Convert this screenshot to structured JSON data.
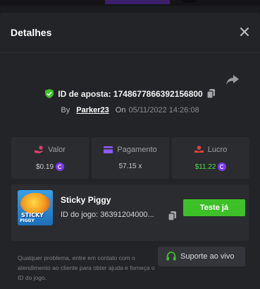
{
  "modal": {
    "title": "Detalhes"
  },
  "bet": {
    "id_label": "ID de aposta: 1748677866392156800",
    "by_label": "By",
    "username": "Parker23",
    "on_label": "On",
    "date": "05/11/2022 14:26:08"
  },
  "stats": {
    "valor": {
      "label": "Valor",
      "value": "$0.19"
    },
    "pagamento": {
      "label": "Pagamento",
      "value": "57.15 x"
    },
    "lucro": {
      "label": "Lucro",
      "value": "$11.22"
    }
  },
  "game": {
    "name": "Sticky Piggy",
    "id_text": "ID do jogo: 36391204000...",
    "thumb_line1": "STICKY",
    "thumb_line2": "PIGGY",
    "play_label": "Teste já"
  },
  "help": {
    "text": "Qualquer problema, entre em contato com o atendimento ao cliente para obter ajuda e forneça o ID do jogo.",
    "support_label": "Suporte ao vivo"
  },
  "icons": {
    "close": "close-icon",
    "share": "share-icon",
    "shield": "shield-check-icon",
    "copy": "copy-icon",
    "valor": "bet-hand-icon",
    "pagamento": "card-icon",
    "lucro": "profit-hand-icon",
    "coin": "coin-icon",
    "headset": "headset-icon"
  },
  "colors": {
    "accent_green": "#3ec028",
    "profit_green": "#4ade4a",
    "coin_purple": "#7c3aed",
    "valor_pink": "#e0406a",
    "pagamento_purple": "#8b5cf6",
    "lucro_red": "#e0403a"
  }
}
